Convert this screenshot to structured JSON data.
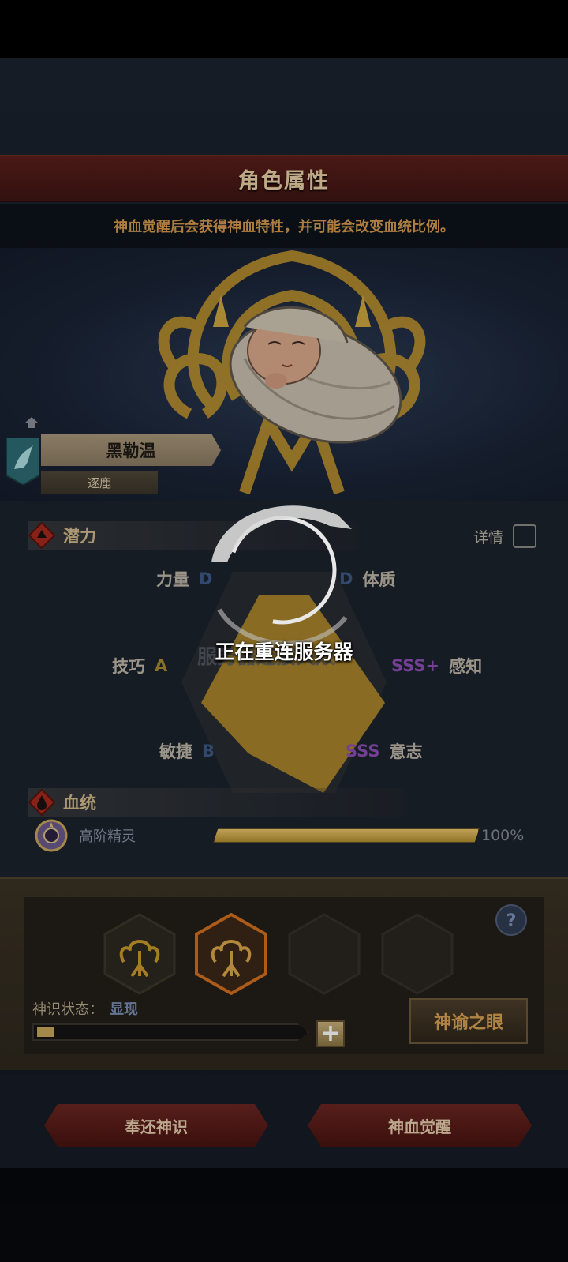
{
  "header": {
    "title": "角色属性",
    "subtitle": "神血觉醒后会获得神血特性，并可能会改变血统比例。"
  },
  "character": {
    "name": "黑勒温",
    "title": "逐鹿"
  },
  "potential": {
    "label": "潜力",
    "detail_label": "详情",
    "stats": [
      {
        "name": "力量",
        "grade": "D"
      },
      {
        "name": "体质",
        "grade": "D"
      },
      {
        "name": "技巧",
        "grade": "A"
      },
      {
        "name": "感知",
        "grade": "SSS+"
      },
      {
        "name": "敏捷",
        "grade": "B"
      },
      {
        "name": "意志",
        "grade": "SSS"
      }
    ],
    "faded_text": "服务器连接失败"
  },
  "lineage": {
    "label": "血统",
    "entries": [
      {
        "name": "高阶精灵",
        "percent_text": "100%",
        "fraction": 1.0
      }
    ]
  },
  "tray": {
    "state_label": "神识状态：",
    "state_value": "显现",
    "state_fraction": 0.06,
    "plus_label": "+",
    "oracle_label": "神谕之眼",
    "help_label": "?"
  },
  "actions": {
    "return_label": "奉还神识",
    "awaken_label": "神血觉醒"
  },
  "overlay": {
    "message": "正在重连服务器"
  },
  "colors": {
    "accent_gold": "#c9a55b",
    "banner_red": "#5a1f1b",
    "grade_purple": "#8e4fb8"
  }
}
